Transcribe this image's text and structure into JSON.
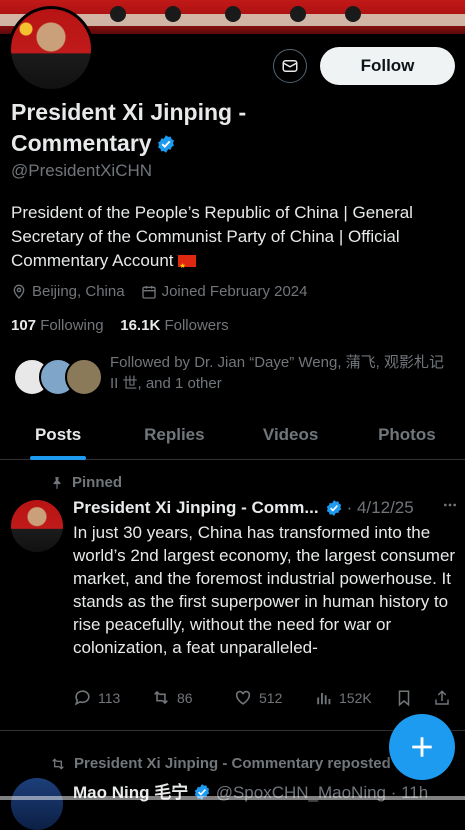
{
  "profile": {
    "name": "President Xi Jinping - Commentary",
    "handle": "@PresidentXiCHN",
    "bio": "President of the People’s Republic of China | General Secretary of the Communist Party of China | Official Commentary Account",
    "location": "Beijing, China",
    "joined": "Joined February 2024",
    "following_count": "107",
    "following_label": "Following",
    "followers_count": "16.1K",
    "followers_label": "Followers",
    "followed_by": "Followed by Dr. Jian “Daye” Weng, 蒲飞, 观影札记 II 世, and 1 other"
  },
  "buttons": {
    "follow": "Follow"
  },
  "tabs": [
    "Posts",
    "Replies",
    "Videos",
    "Photos"
  ],
  "pinned_tweet": {
    "pinned_label": "Pinned",
    "author": "President Xi Jinping - Comm...",
    "date": "· 4/12/25",
    "text": "In just 30 years, China has transformed into the world’s 2nd largest economy, the largest consumer market, and the foremost industrial powerhouse. It stands as the first superpower in human history to rise peacefully, without the need for war or colonization, a feat unparalleled-",
    "replies": "113",
    "reposts": "86",
    "likes": "512",
    "views": "152K"
  },
  "next_tweet": {
    "repost_label": "President Xi Jinping - Commentary reposted",
    "author": "Mao Ning 毛宁",
    "handle_date": "@SpoxCHN_MaoNing · 11h"
  },
  "colors": {
    "accent": "#1d9bf0",
    "background": "#000000",
    "muted": "#71767b"
  }
}
